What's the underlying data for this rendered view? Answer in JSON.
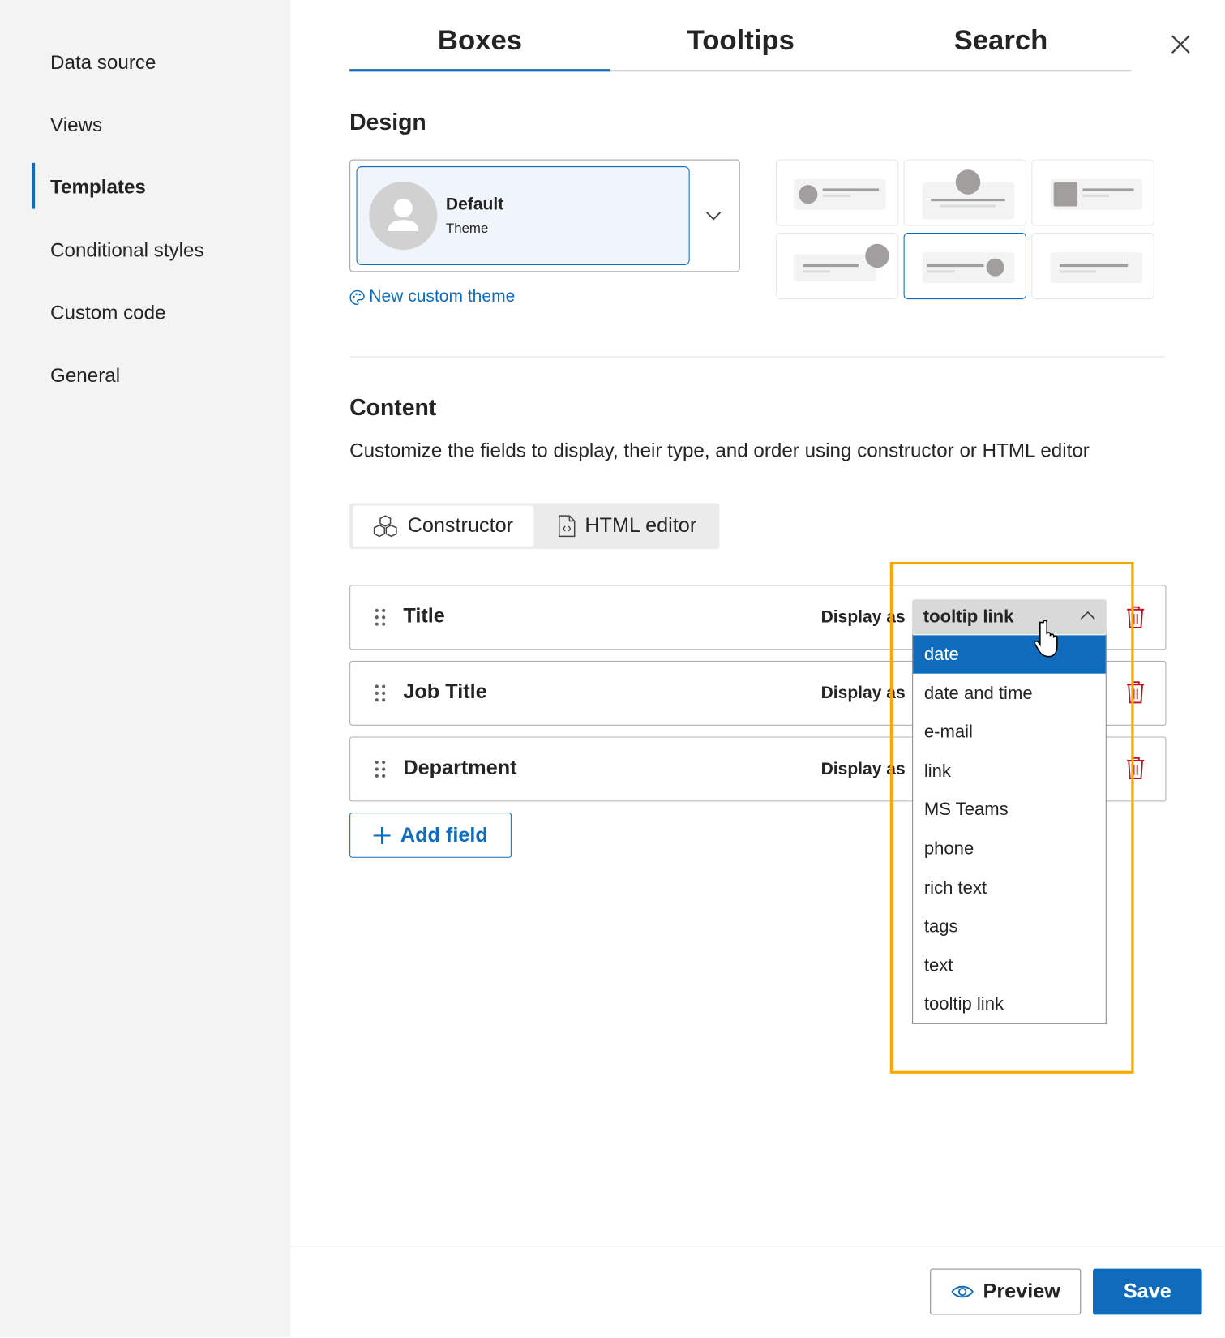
{
  "sidebar": {
    "items": [
      {
        "label": "Data source"
      },
      {
        "label": "Views"
      },
      {
        "label": "Templates",
        "active": true
      },
      {
        "label": "Conditional styles"
      },
      {
        "label": "Custom code"
      },
      {
        "label": "General"
      }
    ]
  },
  "tabs": [
    {
      "label": "Boxes",
      "active": true
    },
    {
      "label": "Tooltips"
    },
    {
      "label": "Search"
    }
  ],
  "design": {
    "heading": "Design",
    "theme_name": "Default",
    "theme_sub": "Theme",
    "new_theme": "New custom theme",
    "selected_layout": 5
  },
  "content": {
    "heading": "Content",
    "description": "Customize the fields to display, their type, and order using constructor or HTML editor",
    "constructor": "Constructor",
    "html_editor": "HTML editor"
  },
  "fields": [
    {
      "name": "Title",
      "display_label": "Display as",
      "value": "tooltip link"
    },
    {
      "name": "Job Title",
      "display_label": "Display as"
    },
    {
      "name": "Department",
      "display_label": "Display as"
    }
  ],
  "add_field": "Add field",
  "dropdown": {
    "options": [
      "date",
      "date and time",
      "e-mail",
      "link",
      "MS Teams",
      "phone",
      "rich text",
      "tags",
      "text",
      "tooltip link"
    ],
    "highlighted": "date"
  },
  "footer": {
    "preview": "Preview",
    "save": "Save"
  },
  "colors": {
    "accent": "#0f6cbd",
    "highlight": "#f7a800",
    "danger": "#c50f1f"
  }
}
